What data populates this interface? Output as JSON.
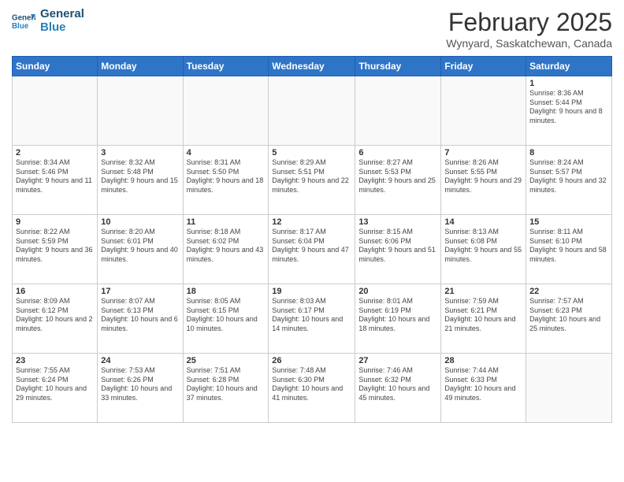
{
  "logo": {
    "line1": "General",
    "line2": "Blue"
  },
  "title": "February 2025",
  "location": "Wynyard, Saskatchewan, Canada",
  "days_of_week": [
    "Sunday",
    "Monday",
    "Tuesday",
    "Wednesday",
    "Thursday",
    "Friday",
    "Saturday"
  ],
  "weeks": [
    [
      {
        "num": "",
        "info": ""
      },
      {
        "num": "",
        "info": ""
      },
      {
        "num": "",
        "info": ""
      },
      {
        "num": "",
        "info": ""
      },
      {
        "num": "",
        "info": ""
      },
      {
        "num": "",
        "info": ""
      },
      {
        "num": "1",
        "info": "Sunrise: 8:36 AM\nSunset: 5:44 PM\nDaylight: 9 hours and 8 minutes."
      }
    ],
    [
      {
        "num": "2",
        "info": "Sunrise: 8:34 AM\nSunset: 5:46 PM\nDaylight: 9 hours and 11 minutes."
      },
      {
        "num": "3",
        "info": "Sunrise: 8:32 AM\nSunset: 5:48 PM\nDaylight: 9 hours and 15 minutes."
      },
      {
        "num": "4",
        "info": "Sunrise: 8:31 AM\nSunset: 5:50 PM\nDaylight: 9 hours and 18 minutes."
      },
      {
        "num": "5",
        "info": "Sunrise: 8:29 AM\nSunset: 5:51 PM\nDaylight: 9 hours and 22 minutes."
      },
      {
        "num": "6",
        "info": "Sunrise: 8:27 AM\nSunset: 5:53 PM\nDaylight: 9 hours and 25 minutes."
      },
      {
        "num": "7",
        "info": "Sunrise: 8:26 AM\nSunset: 5:55 PM\nDaylight: 9 hours and 29 minutes."
      },
      {
        "num": "8",
        "info": "Sunrise: 8:24 AM\nSunset: 5:57 PM\nDaylight: 9 hours and 32 minutes."
      }
    ],
    [
      {
        "num": "9",
        "info": "Sunrise: 8:22 AM\nSunset: 5:59 PM\nDaylight: 9 hours and 36 minutes."
      },
      {
        "num": "10",
        "info": "Sunrise: 8:20 AM\nSunset: 6:01 PM\nDaylight: 9 hours and 40 minutes."
      },
      {
        "num": "11",
        "info": "Sunrise: 8:18 AM\nSunset: 6:02 PM\nDaylight: 9 hours and 43 minutes."
      },
      {
        "num": "12",
        "info": "Sunrise: 8:17 AM\nSunset: 6:04 PM\nDaylight: 9 hours and 47 minutes."
      },
      {
        "num": "13",
        "info": "Sunrise: 8:15 AM\nSunset: 6:06 PM\nDaylight: 9 hours and 51 minutes."
      },
      {
        "num": "14",
        "info": "Sunrise: 8:13 AM\nSunset: 6:08 PM\nDaylight: 9 hours and 55 minutes."
      },
      {
        "num": "15",
        "info": "Sunrise: 8:11 AM\nSunset: 6:10 PM\nDaylight: 9 hours and 58 minutes."
      }
    ],
    [
      {
        "num": "16",
        "info": "Sunrise: 8:09 AM\nSunset: 6:12 PM\nDaylight: 10 hours and 2 minutes."
      },
      {
        "num": "17",
        "info": "Sunrise: 8:07 AM\nSunset: 6:13 PM\nDaylight: 10 hours and 6 minutes."
      },
      {
        "num": "18",
        "info": "Sunrise: 8:05 AM\nSunset: 6:15 PM\nDaylight: 10 hours and 10 minutes."
      },
      {
        "num": "19",
        "info": "Sunrise: 8:03 AM\nSunset: 6:17 PM\nDaylight: 10 hours and 14 minutes."
      },
      {
        "num": "20",
        "info": "Sunrise: 8:01 AM\nSunset: 6:19 PM\nDaylight: 10 hours and 18 minutes."
      },
      {
        "num": "21",
        "info": "Sunrise: 7:59 AM\nSunset: 6:21 PM\nDaylight: 10 hours and 21 minutes."
      },
      {
        "num": "22",
        "info": "Sunrise: 7:57 AM\nSunset: 6:23 PM\nDaylight: 10 hours and 25 minutes."
      }
    ],
    [
      {
        "num": "23",
        "info": "Sunrise: 7:55 AM\nSunset: 6:24 PM\nDaylight: 10 hours and 29 minutes."
      },
      {
        "num": "24",
        "info": "Sunrise: 7:53 AM\nSunset: 6:26 PM\nDaylight: 10 hours and 33 minutes."
      },
      {
        "num": "25",
        "info": "Sunrise: 7:51 AM\nSunset: 6:28 PM\nDaylight: 10 hours and 37 minutes."
      },
      {
        "num": "26",
        "info": "Sunrise: 7:48 AM\nSunset: 6:30 PM\nDaylight: 10 hours and 41 minutes."
      },
      {
        "num": "27",
        "info": "Sunrise: 7:46 AM\nSunset: 6:32 PM\nDaylight: 10 hours and 45 minutes."
      },
      {
        "num": "28",
        "info": "Sunrise: 7:44 AM\nSunset: 6:33 PM\nDaylight: 10 hours and 49 minutes."
      },
      {
        "num": "",
        "info": ""
      }
    ]
  ]
}
